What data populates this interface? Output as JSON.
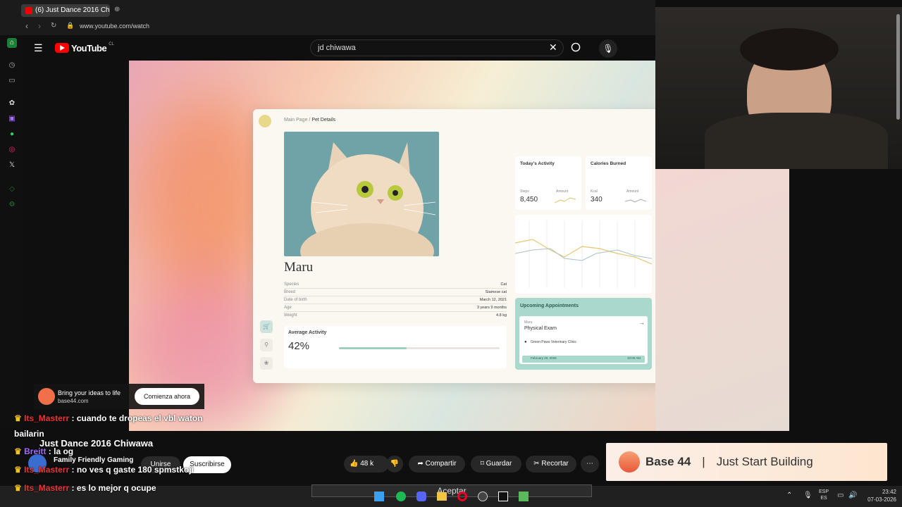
{
  "browser": {
    "tab_title": "(6) Just Dance 2016 Ch",
    "url": "www.youtube.com/watch"
  },
  "youtube": {
    "logo": "YouTube",
    "region": "CL",
    "search_value": "jd chiwawa"
  },
  "pet_card": {
    "breadcrumb_root": "Main Page",
    "breadcrumb_sep": "/",
    "breadcrumb_current": "Pet Details",
    "pet_name": "Maru",
    "details": [
      {
        "label": "Species",
        "value": "Cat"
      },
      {
        "label": "Breed",
        "value": "Siamese cat"
      },
      {
        "label": "Date of birth",
        "value": "March 12, 2021"
      },
      {
        "label": "Age",
        "value": "3 years 9 months"
      },
      {
        "label": "Weight",
        "value": "4.8 kg"
      }
    ],
    "average_activity": {
      "title": "Average Activity",
      "percent": "42%",
      "progress": 0.42
    },
    "today_activity": {
      "title": "Today's Activity",
      "label1": "Steps",
      "label2": "Amount",
      "value": "8,450"
    },
    "calories": {
      "title": "Calories Burned",
      "label1": "Kcal",
      "label2": "Amount",
      "value": "340"
    },
    "appointments": {
      "title": "Upcoming Appointments",
      "pet": "Maru",
      "type": "Physical Exam",
      "clinic": "Green Paws Veterinary Clinic",
      "date": "February 20, 2026",
      "time": "10:00 AM"
    }
  },
  "ad": {
    "line1": "Bring your ideas to life",
    "line2": "base44.com",
    "cta": "Comienza ahora"
  },
  "video": {
    "title": "Just Dance 2016 Chiwawa",
    "channel": "Family Friendly Gaming",
    "join": "Unirse",
    "subscribe": "Suscribirse",
    "likes": "48 k",
    "share": "Compartir",
    "save": "Guardar",
    "clip": "Recortar"
  },
  "chat": [
    {
      "user": "Its_Masterr",
      "msg": "cuando te dropeas el vbl waton"
    },
    {
      "user": "",
      "msg": "bailarin"
    },
    {
      "user": "Breitt",
      "msg": "la og"
    },
    {
      "user": "Its_Masterr",
      "msg": "no ves q gaste 180 spmstkoji"
    },
    {
      "user": "Its_Masterr",
      "msg": "es lo mejor q ocupe"
    }
  ],
  "banner": {
    "brand": "Base 44",
    "sep": "|",
    "tagline": "Just Start Building"
  },
  "taskbar": {
    "lang1": "ESP",
    "lang2": "ES",
    "time": "23:42",
    "date": "07-03-2026",
    "popup": "Aceptar"
  }
}
